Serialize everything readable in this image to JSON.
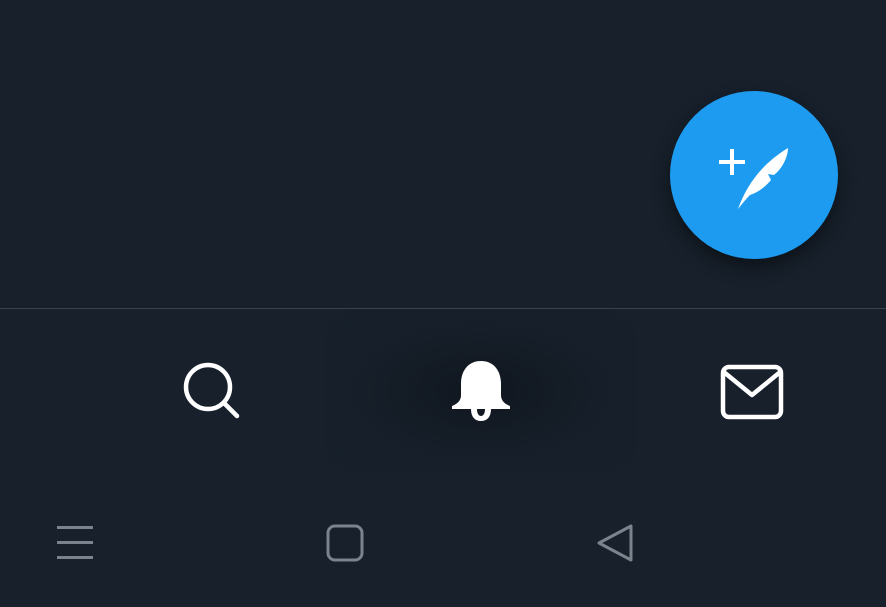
{
  "compose": {
    "icon": "compose-feather-plus-icon",
    "color": "#1d9bf0"
  },
  "bottom_nav": {
    "items": [
      {
        "id": "search",
        "icon": "search-icon"
      },
      {
        "id": "notifications",
        "icon": "bell-icon",
        "selected": true
      },
      {
        "id": "messages",
        "icon": "mail-icon"
      }
    ]
  },
  "system_nav": {
    "items": [
      {
        "id": "menu",
        "icon": "menu-icon"
      },
      {
        "id": "home",
        "icon": "square-home-icon"
      },
      {
        "id": "back",
        "icon": "triangle-back-icon"
      }
    ]
  },
  "colors": {
    "background": "#17202b",
    "divider": "#38444d",
    "icon": "#ffffff",
    "system_icon": "#7b848d"
  }
}
